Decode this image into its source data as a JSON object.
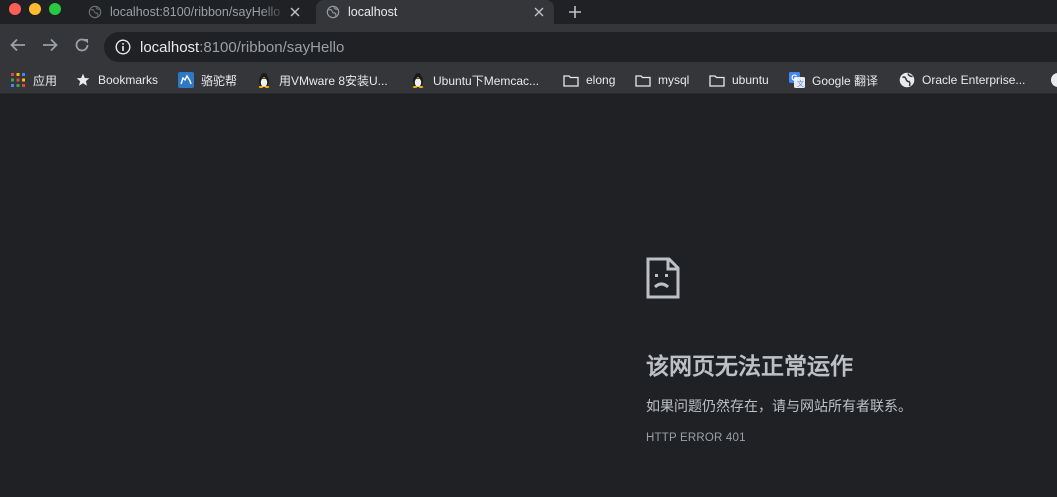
{
  "tabs": [
    {
      "title": "localhost:8100/ribbon/sayHello",
      "active": false
    },
    {
      "title": "localhost",
      "active": true
    }
  ],
  "toolbar": {
    "url_host": "localhost",
    "url_rest": ":8100/ribbon/sayHello"
  },
  "bookmarks": {
    "apps": "应用",
    "items": [
      {
        "label": "Bookmarks",
        "icon": "star-icon"
      },
      {
        "label": "骆驼帮",
        "icon": "camel-site-icon"
      },
      {
        "label": "用VMware 8安装U...",
        "icon": "penguin-icon"
      },
      {
        "label": "Ubuntu下Memcac...",
        "icon": "penguin-icon"
      },
      {
        "label": "elong",
        "icon": "folder-icon"
      },
      {
        "label": "mysql",
        "icon": "folder-icon"
      },
      {
        "label": "ubuntu",
        "icon": "folder-icon"
      },
      {
        "label": "Google 翻译",
        "icon": "google-translate-icon"
      },
      {
        "label": "Oracle Enterprise...",
        "icon": "globe-icon"
      }
    ]
  },
  "error": {
    "title": "该网页无法正常运作",
    "description": "如果问题仍然存在，请与网站所有者联系。",
    "code": "HTTP ERROR 401"
  },
  "colors": {
    "background": "#202124",
    "toolbar": "#35363a",
    "text": "#e8eaed",
    "muted": "#9aa0a6"
  }
}
